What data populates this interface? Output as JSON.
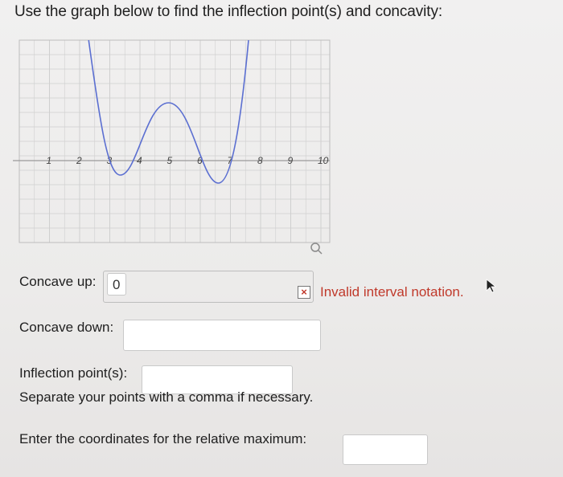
{
  "question": {
    "title": "Use the graph below to find the inflection point(s) and concavity:"
  },
  "graph": {
    "x_tick_labels": [
      "1",
      "2",
      "3",
      "4",
      "5",
      "6",
      "7",
      "8",
      "9",
      "10"
    ],
    "curve_color": "#5b6fd1",
    "zoom_icon": "magnifier-icon"
  },
  "form": {
    "concave_up": {
      "label": "Concave up:",
      "value": "0",
      "error_icon": "x-icon",
      "error_text": "Invalid interval notation."
    },
    "concave_down": {
      "label": "Concave down:",
      "value": ""
    },
    "inflection_points": {
      "label": "Inflection point(s):",
      "value": "",
      "hint": "Separate your points with a comma if necessary."
    },
    "relative_maximum": {
      "label": "Enter the coordinates for the relative maximum:",
      "value": ""
    }
  },
  "colors": {
    "error": "#c0392b",
    "grid": "#cfcfcf"
  }
}
